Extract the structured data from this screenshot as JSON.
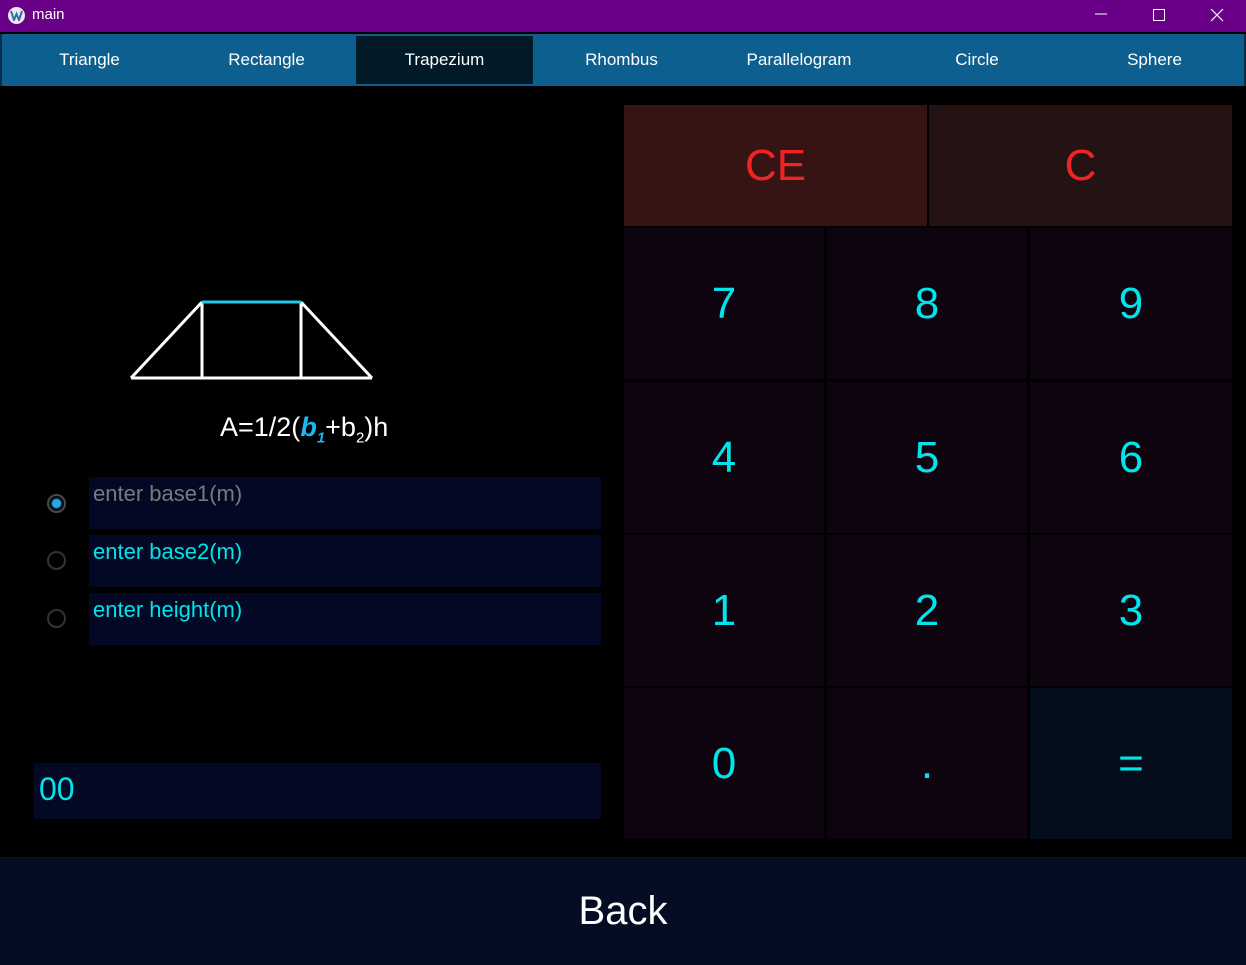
{
  "window": {
    "title": "main"
  },
  "tabs": [
    "Triangle",
    "Rectangle",
    "Trapezium",
    "Rhombus",
    "Parallelogram",
    "Circle",
    "Sphere"
  ],
  "active_tab": "Trapezium",
  "formula": {
    "prefix": "A=1/2(",
    "b1": "b",
    "b1_sub": "1",
    "plus": "+b",
    "b2_sub": "2",
    "suffix": ")h"
  },
  "inputs": [
    {
      "placeholder": "enter base1(m)",
      "selected": true
    },
    {
      "placeholder": "enter base2(m)",
      "selected": false
    },
    {
      "placeholder": "enter height(m)",
      "selected": false
    }
  ],
  "result": {
    "value": "00"
  },
  "keypad": {
    "ce": "CE",
    "c": "C",
    "k7": "7",
    "k8": "8",
    "k9": "9",
    "k4": "4",
    "k5": "5",
    "k6": "6",
    "k1": "1",
    "k2": "2",
    "k3": "3",
    "k0": "0",
    "dot": ".",
    "eq": "="
  },
  "back_label": "Back",
  "colors": {
    "titlebar": "#6a0088",
    "tabbar": "#0c5f8f",
    "accent": "#00e5ea",
    "clear": "#f02424"
  }
}
